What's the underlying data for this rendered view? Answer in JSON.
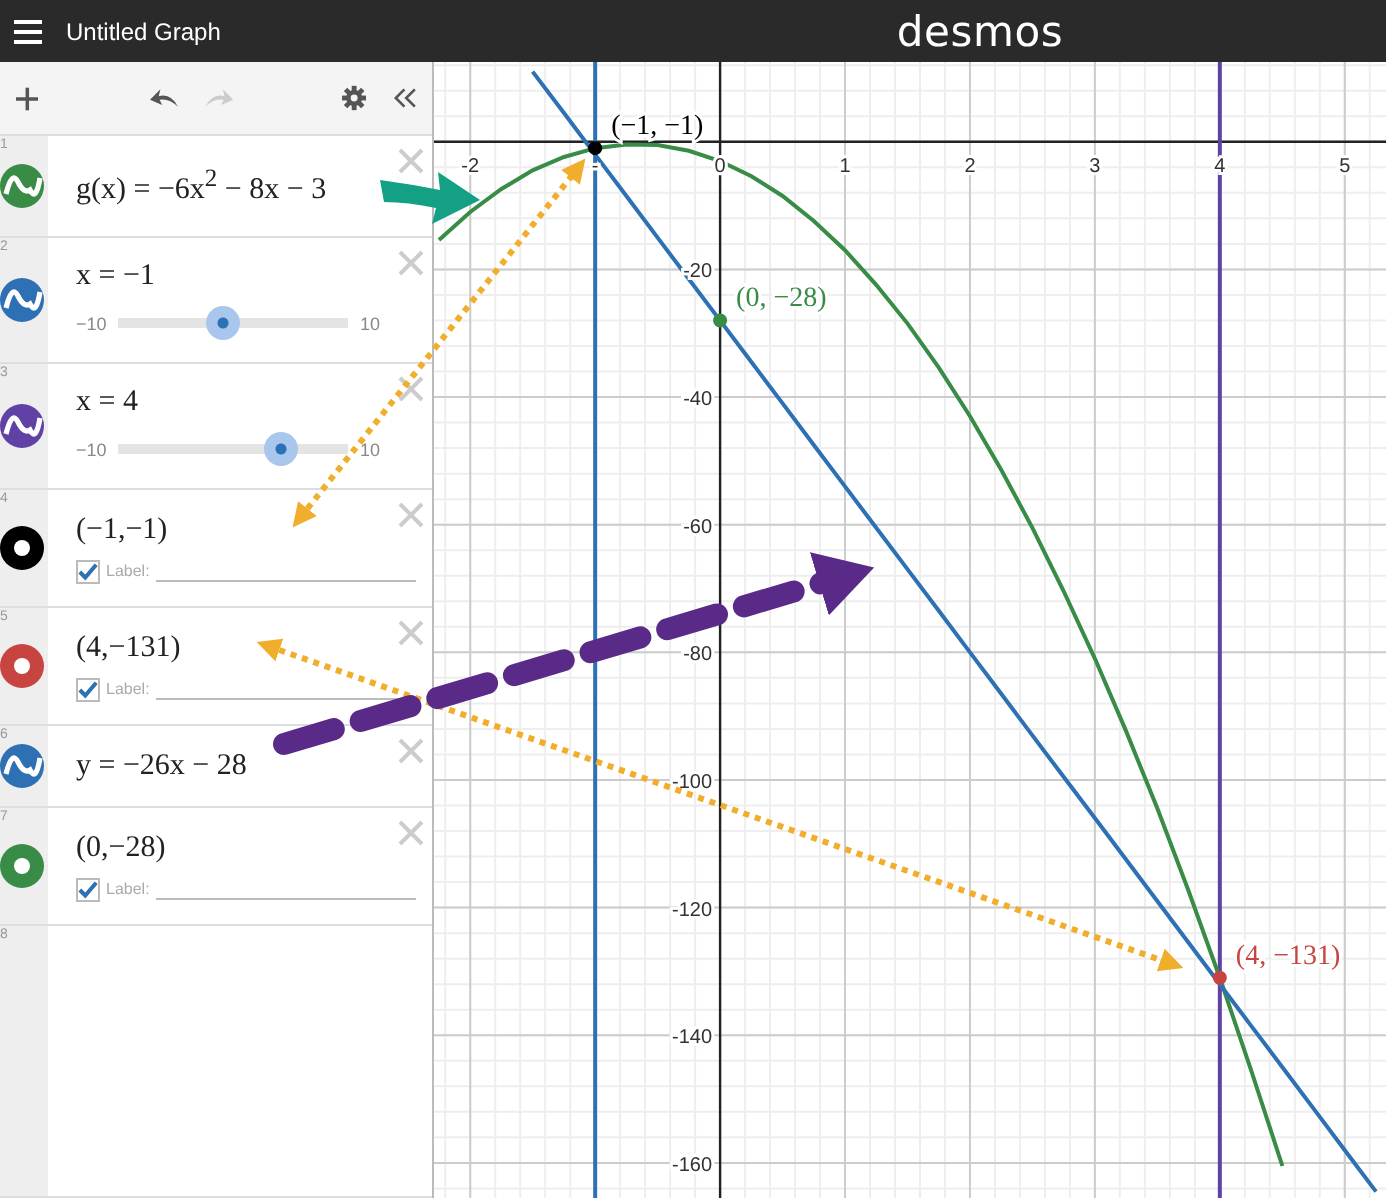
{
  "header": {
    "title": "Untitled Graph",
    "logo": "desmos"
  },
  "toolbar": {
    "redo_disabled": true
  },
  "expressions": [
    {
      "kind": "function",
      "number": "1",
      "color": "#388c46",
      "text": "g(x) = −6x$^{2}$ − 8x − 3"
    },
    {
      "kind": "slider",
      "number": "2",
      "color": "#2d70b3",
      "text": "x = −1",
      "min": "−10",
      "max": "10",
      "level": 0.45
    },
    {
      "kind": "slider",
      "number": "3",
      "color": "#6042a6",
      "text": "x = 4",
      "min": "−10",
      "max": "10",
      "level": 0.7
    },
    {
      "kind": "point",
      "number": "4",
      "color": "#000000",
      "text": "(−1,−1)",
      "label": {
        "checked": true,
        "text": "Label:"
      }
    },
    {
      "kind": "point",
      "number": "5",
      "color": "#c74440",
      "text": "(4,−131)",
      "label": {
        "checked": true,
        "text": "Label:"
      }
    },
    {
      "kind": "function",
      "number": "6",
      "color": "#2d70b3",
      "text": "y = −26x − 28"
    },
    {
      "kind": "point",
      "number": "7",
      "color": "#388c46",
      "text": "(0,−28)",
      "label": {
        "checked": true,
        "text": "Label:"
      }
    },
    {
      "kind": "empty",
      "number": "8"
    }
  ],
  "graph": {
    "chart_data": {
      "type": "line",
      "x": [
        -2.25,
        -2,
        -1.75,
        -1.5,
        -1.25,
        -1,
        -0.75,
        -0.5,
        -0.25,
        0,
        0.25,
        0.5,
        0.75,
        1,
        1.25,
        1.5,
        1.75,
        2,
        2.25,
        2.5,
        2.75,
        3,
        3.25,
        3.5,
        3.75,
        4,
        4.25,
        4.5,
        4.75,
        5,
        5.25
      ],
      "series": [
        {
          "color": "#388c46",
          "values": [
            -15.4,
            -11,
            -7.4,
            -4.5,
            -2.4,
            -1,
            -0.4,
            -0.5,
            -1.4,
            -3,
            -5.4,
            -8.5,
            -12.4,
            -17,
            -22.4,
            -28.5,
            -35.4,
            -43,
            -51.4,
            -60.5,
            -70.4,
            -81,
            -92.4,
            -104.5,
            -117.4,
            -131,
            -145.4,
            -160.5,
            null,
            null,
            null
          ]
        },
        {
          "color": "#2d70b3",
          "values": [
            null,
            null,
            null,
            11,
            4.5,
            -2,
            -8.5,
            -15,
            -21.5,
            -28,
            -34.5,
            -41,
            -47.5,
            -54,
            -60.5,
            -67,
            -73.5,
            -80,
            -86.5,
            -93,
            -99.5,
            -106,
            -112.5,
            -119,
            -125.5,
            -132,
            -138.5,
            -145,
            -151.5,
            -158,
            -164.5
          ]
        }
      ],
      "xlim": [
        -2.29,
        5.33
      ],
      "ylim": [
        -165.5,
        12.5
      ],
      "xticks": [
        -2,
        {
          "value": -1,
          "label": "-"
        },
        {
          "value": 0,
          "label": "0"
        },
        1,
        2,
        3,
        4,
        5
      ],
      "yticks": [
        -160,
        -140,
        -120,
        -100,
        -80,
        -60,
        -40,
        -20
      ],
      "grid": true,
      "ref_lines": [
        {
          "axis": "x",
          "value": -1
        },
        {
          "axis": "x",
          "value": 4
        }
      ],
      "annotations": [
        {
          "x": -1,
          "y": -1,
          "text": "(−1, −1)"
        },
        {
          "x": 4,
          "y": -131,
          "text": "(4, −131)"
        },
        {
          "x": 0,
          "y": -28,
          "text": "(0, −28)"
        }
      ]
    }
  }
}
